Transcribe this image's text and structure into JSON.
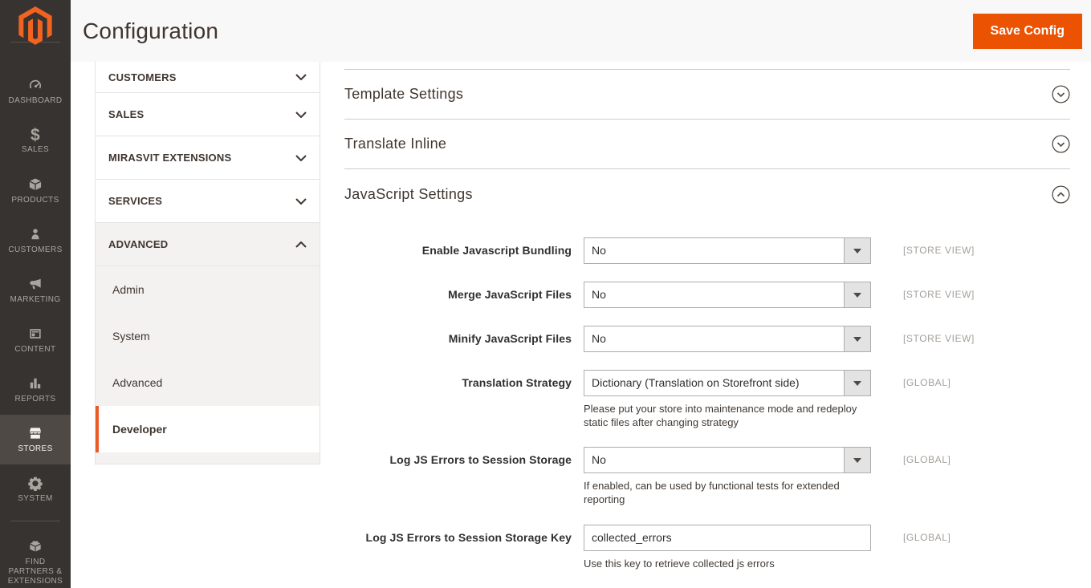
{
  "header": {
    "title": "Configuration",
    "save_label": "Save Config"
  },
  "sidebar": {
    "items": [
      {
        "label": "DASHBOARD",
        "icon": "dashboard-icon",
        "active": false
      },
      {
        "label": "SALES",
        "icon": "sales-icon",
        "icon_glyph": "$",
        "active": false
      },
      {
        "label": "PRODUCTS",
        "icon": "products-icon",
        "active": false
      },
      {
        "label": "CUSTOMERS",
        "icon": "customers-icon",
        "active": false
      },
      {
        "label": "MARKETING",
        "icon": "marketing-icon",
        "active": false
      },
      {
        "label": "CONTENT",
        "icon": "content-icon",
        "active": false
      },
      {
        "label": "REPORTS",
        "icon": "reports-icon",
        "active": false
      },
      {
        "label": "STORES",
        "icon": "stores-icon",
        "active": true
      },
      {
        "label": "SYSTEM",
        "icon": "system-icon",
        "active": false
      },
      {
        "label": "FIND PARTNERS & EXTENSIONS",
        "icon": "find-partners-icon",
        "active": false
      }
    ]
  },
  "config_nav": {
    "groups": [
      {
        "label": "CUSTOMERS",
        "state": "collapsed"
      },
      {
        "label": "SALES",
        "state": "collapsed"
      },
      {
        "label": "MIRASVIT EXTENSIONS",
        "state": "collapsed"
      },
      {
        "label": "SERVICES",
        "state": "collapsed"
      },
      {
        "label": "ADVANCED",
        "state": "expanded"
      }
    ],
    "advanced_items": [
      {
        "label": "Admin",
        "current": false
      },
      {
        "label": "System",
        "current": false
      },
      {
        "label": "Advanced",
        "current": false
      },
      {
        "label": "Developer",
        "current": true
      }
    ]
  },
  "main": {
    "sections": [
      {
        "title": "Template Settings",
        "state": "collapsed"
      },
      {
        "title": "Translate Inline",
        "state": "collapsed"
      },
      {
        "title": "JavaScript Settings",
        "state": "expanded"
      }
    ],
    "form": {
      "rows": [
        {
          "label": "Enable Javascript Bundling",
          "type": "select",
          "value": "No",
          "scope": "[STORE VIEW]",
          "note": ""
        },
        {
          "label": "Merge JavaScript Files",
          "type": "select",
          "value": "No",
          "scope": "[STORE VIEW]",
          "note": ""
        },
        {
          "label": "Minify JavaScript Files",
          "type": "select",
          "value": "No",
          "scope": "[STORE VIEW]",
          "note": ""
        },
        {
          "label": "Translation Strategy",
          "type": "select",
          "value": "Dictionary (Translation on Storefront side)",
          "scope": "[GLOBAL]",
          "note": "Please put your store into maintenance mode and redeploy static files after changing strategy"
        },
        {
          "label": "Log JS Errors to Session Storage",
          "type": "select",
          "value": "No",
          "scope": "[GLOBAL]",
          "note": "If enabled, can be used by functional tests for extended reporting"
        },
        {
          "label": "Log JS Errors to Session Storage Key",
          "type": "text",
          "value": "collected_errors",
          "scope": "[GLOBAL]",
          "note": "Use this key to retrieve collected js errors"
        }
      ]
    }
  },
  "colors": {
    "accent_orange": "#eb5202",
    "logo_orange": "#f26322",
    "sidebar_bg": "#373330",
    "sidebar_active_bg": "#4e4945",
    "content_divider": "#cccccc",
    "input_border": "#adadad",
    "scope_text": "#a5a09b"
  }
}
